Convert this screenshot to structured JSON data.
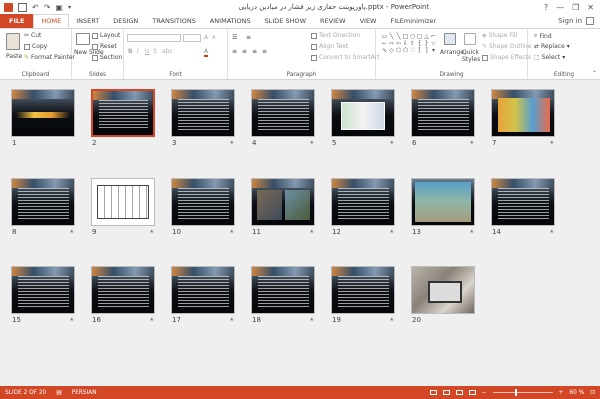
{
  "window": {
    "title": "پاورپوینت حفاری زیر فشار در میادین دریایی.pptx - PowerPoint",
    "controls": [
      "?",
      "—",
      "❐",
      "✕"
    ]
  },
  "tabs": [
    {
      "label": "FILE"
    },
    {
      "label": "HOME"
    },
    {
      "label": "INSERT"
    },
    {
      "label": "DESIGN"
    },
    {
      "label": "TRANSITIONS"
    },
    {
      "label": "ANIMATIONS"
    },
    {
      "label": "SLIDE SHOW"
    },
    {
      "label": "REVIEW"
    },
    {
      "label": "VIEW"
    },
    {
      "label": "FILEminimizer"
    }
  ],
  "signin": "Sign in",
  "ribbon": {
    "clipboard": {
      "paste": "Paste",
      "cut": "Cut",
      "copy": "Copy",
      "format_painter": "Format Painter",
      "label": "Clipboard"
    },
    "slides": {
      "new_slide": "New Slide",
      "layout": "Layout",
      "reset": "Reset",
      "section": "Section",
      "label": "Slides"
    },
    "font": {
      "label": "Font",
      "bold": "B",
      "italic": "I",
      "underline": "U",
      "strike": "S",
      "shadow": "abc",
      "grow": "A",
      "shrink": "A"
    },
    "paragraph": {
      "text_direction": "Text Direction",
      "align_text": "Align Text",
      "smartart": "Convert to SmartArt",
      "label": "Paragraph"
    },
    "drawing": {
      "arrange": "Arrange",
      "quick_styles": "Quick Styles",
      "shape_fill": "Shape Fill",
      "shape_outline": "Shape Outline",
      "shape_effects": "Shape Effects",
      "label": "Drawing"
    },
    "editing": {
      "find": "Find",
      "replace": "Replace",
      "select": "Select",
      "label": "Editing"
    }
  },
  "slides": [
    {
      "num": "1"
    },
    {
      "num": "2"
    },
    {
      "num": "3"
    },
    {
      "num": "4"
    },
    {
      "num": "5"
    },
    {
      "num": "6"
    },
    {
      "num": "7"
    },
    {
      "num": "8"
    },
    {
      "num": "9"
    },
    {
      "num": "10"
    },
    {
      "num": "11"
    },
    {
      "num": "12"
    },
    {
      "num": "13"
    },
    {
      "num": "14"
    },
    {
      "num": "15"
    },
    {
      "num": "16"
    },
    {
      "num": "17"
    },
    {
      "num": "18"
    },
    {
      "num": "19"
    },
    {
      "num": "20"
    }
  ],
  "slide_star": "★",
  "status": {
    "slide": "SLIDE 2 OF 20",
    "language": "PERSIAN",
    "zoom": "60 %",
    "zoom_minus": "−",
    "zoom_plus": "+"
  },
  "colors": {
    "accent": "#d24726"
  }
}
